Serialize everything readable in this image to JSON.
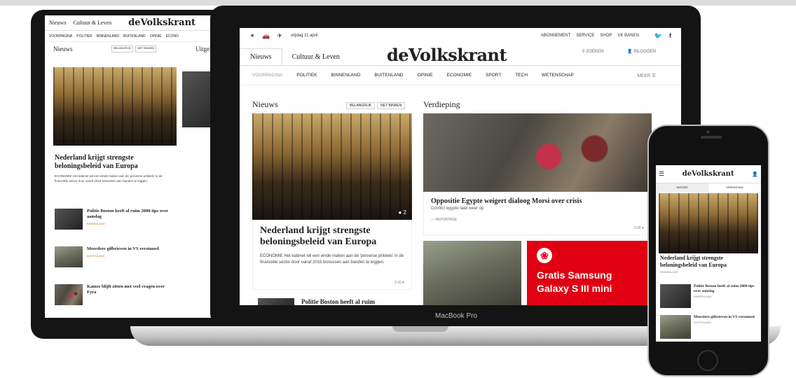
{
  "colors": {
    "accent_red": "#e00012",
    "device_black": "#141414"
  },
  "tablet": {
    "tabs": [
      "Nieuws",
      "Cultuur & Leven"
    ],
    "logo": "deVolkskrant",
    "nav": [
      "VOORPAGINA",
      "POLITIEK",
      "BINNENLAND",
      "BUITENLAND",
      "OPINIE",
      "ECONO"
    ],
    "section_left": "Nieuws",
    "section_right": "Uitgelic",
    "pills": [
      "BELANGRIJK",
      "NET BINNEN"
    ],
    "headline": "Nederland krijgt strengste beloningsbeleid van Europa",
    "lede": "ECONOMIE Het kabinet wil een einde maken aan de 'perverse prikkels' in de financiële sector door vanaf 2015 bonussen aan banden te leggen.",
    "items": [
      {
        "title": "Politie Boston heeft al ruim 2000 tips over aanslag",
        "category": "BINNENLAND"
      },
      {
        "title": "Meerdere gifbrieven in VS verstuurd",
        "category": "BUITENLAND"
      },
      {
        "title": "Kamer blijft zitten met veel vragen over Fyra",
        "category": ""
      }
    ]
  },
  "laptop": {
    "top_icons": [
      "sun-icon",
      "car-icon",
      "plane-icon"
    ],
    "date": "vrijdag 11 april",
    "top_links": [
      "ABONNEMENT",
      "SERVICE",
      "SHOP",
      "VK BANEN"
    ],
    "tabs": [
      "Nieuws",
      "Cultuur & Leven"
    ],
    "logo": "deVolkskrant",
    "search_label": "ZOEKEN",
    "login_label": "INLOGGEN",
    "nav": [
      "VOORPAGINA",
      "POLITIEK",
      "BINNENLAND",
      "BUITENLAND",
      "OPINIE",
      "ECONOMIE",
      "SPORT",
      "TECH",
      "WETENSCHAP"
    ],
    "nav_more": "MEER",
    "section_news": "Nieuws",
    "pills": [
      "BELANGRIJK",
      "NET BINNEN"
    ],
    "section_deep": "Verdieping",
    "main_headline": "Nederland krijgt strengste beloningsbeleid van Europa",
    "main_lede": "ECONOMIE Het kabinet wil een einde maken aan de 'perverse prikkels' in de financiële sector door vanaf 2015 bonussen aan banden te leggen.",
    "main_meta": "2:05",
    "photo_badge": "● 2",
    "next_headline": "Politie Boston heeft al ruim",
    "deep_headline": "Oppositie Egypte weigert dialoog Morsi over crisis",
    "deep_sub": "Conflict egypte laait weer op",
    "deep_tag": "— REPORTAGE",
    "deep_meta": "2:05",
    "ad_text": "Gratis Samsung Galaxy S III mini",
    "ad_logo": "❀",
    "macbook_label": "MacBook Pro"
  },
  "phone": {
    "logo": "deVolkskrant",
    "tabs": [
      "NIEUWS",
      "VERDIEPING"
    ],
    "headline": "Nederland krijgt strengste beloningsbeleid van Europa",
    "category": "BINNENLAND",
    "items": [
      {
        "title": "Politie Boston heeft al ruim 2000 tips over aanslag",
        "category": "BINNENLAND"
      },
      {
        "title": "Meerdere gifbrieven in VS verstuurd",
        "category": "BUITENLAND"
      }
    ]
  }
}
